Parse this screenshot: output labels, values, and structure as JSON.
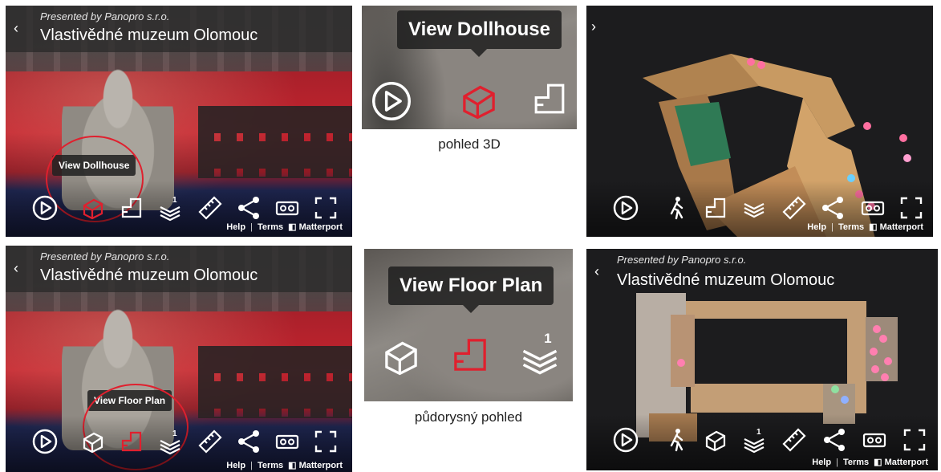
{
  "viewer": {
    "presented_prefix": "Presented by ",
    "presenter": "Panopro s.r.o.",
    "title": "Vlastivědné muzeum Olomouc",
    "footer": {
      "help": "Help",
      "separator": "|",
      "terms": "Terms",
      "brand": "Matterport"
    }
  },
  "tooltips": {
    "dollhouse": "View Dollhouse",
    "floor_plan": "View Floor Plan"
  },
  "captions": {
    "view_3d": "pohled 3D",
    "floor_plan": "půdorysný pohled"
  },
  "floor_badge": "1",
  "colors": {
    "accent": "#e0202e",
    "tooltip_bg": "#222222",
    "header_bg": "#282828"
  },
  "icons": [
    "play-icon",
    "dollhouse-icon",
    "floorplan-icon",
    "floors-icon",
    "measure-icon",
    "share-icon",
    "vr-icon",
    "fullscreen-icon",
    "walk-icon",
    "back-chevron-icon",
    "forward-chevron-icon"
  ]
}
